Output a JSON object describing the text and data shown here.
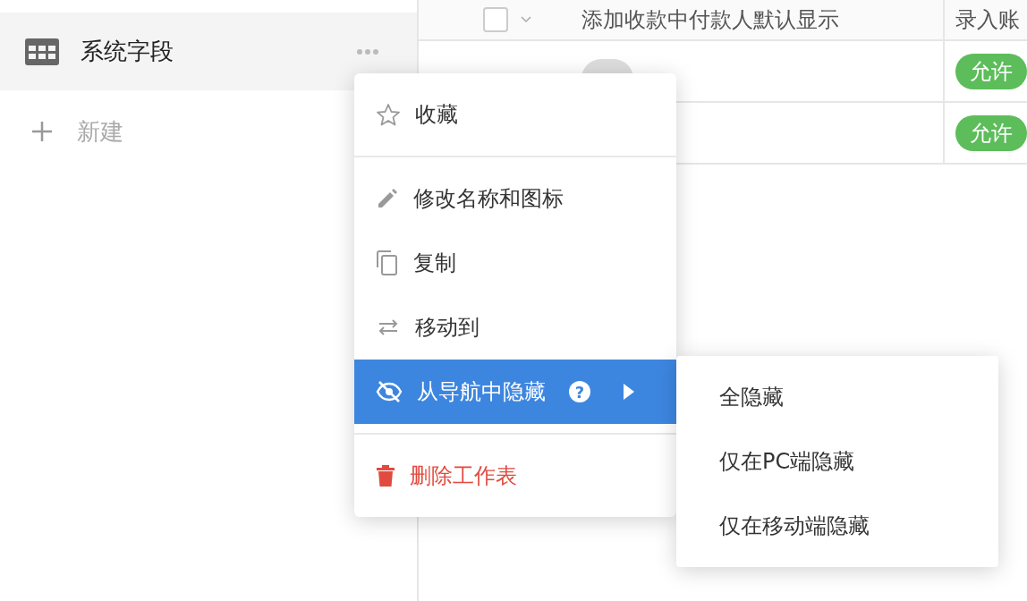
{
  "sidebar": {
    "items": [
      {
        "label": "系统字段",
        "selected": true
      }
    ],
    "new_label": "新建"
  },
  "table": {
    "select_all": {
      "checked": false
    },
    "columns": [
      "添加收款中付款人默认显示",
      "录入账"
    ],
    "rows": [
      {
        "status": "允许"
      },
      {
        "status": "允许"
      }
    ]
  },
  "menu": {
    "sections": [
      [
        {
          "label": "收藏",
          "kind": "normal",
          "selected": false
        }
      ],
      [
        {
          "label": "修改名称和图标",
          "kind": "normal",
          "selected": false
        },
        {
          "label": "复制",
          "kind": "normal",
          "selected": false
        },
        {
          "label": "移动到",
          "kind": "normal",
          "selected": false
        },
        {
          "label": "从导航中隐藏",
          "kind": "normal",
          "selected": true,
          "help": "?",
          "submenu": true
        }
      ],
      [
        {
          "label": "删除工作表",
          "kind": "danger",
          "selected": false
        }
      ]
    ]
  },
  "submenu": {
    "items": [
      {
        "label": "全隐藏"
      },
      {
        "label": "仅在PC端隐藏"
      },
      {
        "label": "仅在移动端隐藏"
      }
    ]
  }
}
